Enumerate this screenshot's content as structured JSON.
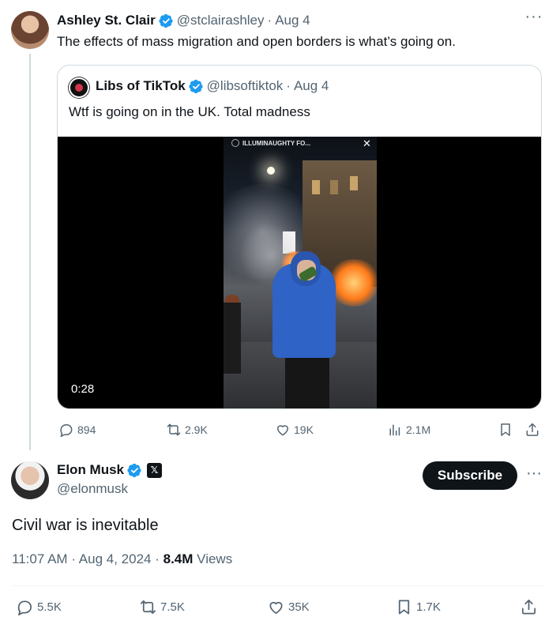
{
  "parent_tweet": {
    "author_name": "Ashley St. Clair",
    "handle": "@stclairashley",
    "separator": "·",
    "date": "Aug 4",
    "text": "The effects of mass migration and open borders is what’s going on.",
    "more_icon": "more-horizontal-icon",
    "quoted_tweet": {
      "author_name": "Libs of TikTok",
      "handle": "@libsoftiktok",
      "separator": "·",
      "date": "Aug 4",
      "text": "Wtf is going on in the UK. Total madness",
      "video": {
        "duration": "0:28",
        "overlay_text": "ILLUMINAUGHTY FO...",
        "close_glyph": "✕"
      }
    },
    "actions": {
      "replies": "894",
      "reposts": "2.9K",
      "likes": "19K",
      "views": "2.1M"
    }
  },
  "main_tweet": {
    "author_name": "Elon Musk",
    "handle": "@elonmusk",
    "affiliate_badge": "𝕏",
    "subscribe_label": "Subscribe",
    "text": "Civil war is inevitable",
    "time": "11:07 AM",
    "date": "Aug 4, 2024",
    "separator": "·",
    "views_count": "8.4M",
    "views_label": "Views",
    "actions": {
      "replies": "5.5K",
      "reposts": "7.5K",
      "likes": "35K",
      "bookmarks": "1.7K"
    }
  },
  "colors": {
    "verified_blue": "#1d9bf0",
    "text_primary": "#0f1419",
    "text_muted": "#536471",
    "border": "#cfd9de"
  }
}
